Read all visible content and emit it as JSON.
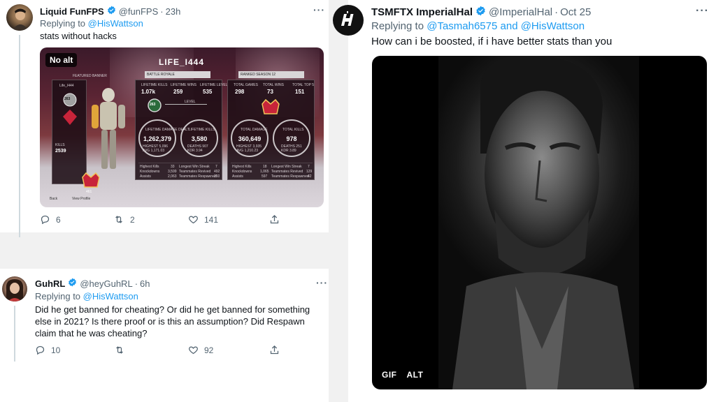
{
  "tweets": {
    "t1": {
      "name": "Liquid FunFPS",
      "handle": "@funFPS",
      "time": "23h",
      "reply_prefix": "Replying to",
      "reply_to": "@HisWattson",
      "text": "stats without hacks",
      "stats": {
        "replies": "6",
        "retweets": "2",
        "likes": "141"
      }
    },
    "t2": {
      "name": "GuhRL",
      "handle": "@heyGuhRL",
      "time": "6h",
      "reply_prefix": "Replying to",
      "reply_to": "@HisWattson",
      "text": "Did he get banned for cheating? Or did he get banned for something else in 2021? Is there proof or is this an assumption? Did Respawn claim that he was cheating?",
      "stats": {
        "replies": "10",
        "retweets": "",
        "likes": "92"
      }
    },
    "t3": {
      "name": "TSMFTX ImperialHal",
      "handle": "@ImperialHal",
      "time": "Oct 25",
      "reply_prefix": "Replying to",
      "reply_to": "@Tasmah6575 and @HisWattson",
      "text": "How can i be boosted, if i have better stats than you",
      "gif_label": "GIF",
      "alt_label": "ALT"
    }
  },
  "dot_separator": "·",
  "more_label": "···",
  "game": {
    "no_alt": "No alt",
    "player_title": "LIFE_I444",
    "featured_banner": "FEATURED BANNER",
    "banner_name": "Life_I444",
    "banner_rank": "263",
    "banner_stat_label": "KILLS",
    "banner_stat_value": "2539",
    "mode_dropdown": "BATTLE ROYALE",
    "ranked_dropdown": "RANKED SEASON 12",
    "left_tiles": [
      {
        "label": "LIFETIME KILLS",
        "value": "1.07k"
      },
      {
        "label": "LIFETIME WINS",
        "value": "259"
      },
      {
        "label": "LIFETIME LEVEL",
        "value": "535"
      }
    ],
    "level_label": "LEVEL",
    "level_value": "263",
    "lifetime_damage_label": "LIFETIME DAMAGE DEALT",
    "lifetime_damage": "1,262,379",
    "lifetime_damage_high": "HIGHEST 5,096",
    "lifetime_damage_avg": "AVG 1,171.03",
    "lifetime_kills_label": "LIFETIME KILLS",
    "lifetime_kills": "3,580",
    "lifetime_kills_high": "DEATHS 907",
    "lifetime_kills_kd": "KDR 3.94",
    "right_tiles": [
      {
        "label": "TOTAL GAMES",
        "value": "298"
      },
      {
        "label": "TOTAL WINS",
        "value": "73"
      },
      {
        "label": "TOTAL TOP 5",
        "value": "151"
      }
    ],
    "total_damage_label": "TOTAL DAMAGE",
    "total_damage": "360,649",
    "total_damage_high": "HIGHEST 3,935",
    "total_damage_avg": "AVG 1,210.23",
    "total_kills_label": "TOTAL KILLS",
    "total_kills": "978",
    "total_kills_deaths": "DEATHS 251",
    "total_kills_kd": "KDR 3.89",
    "left_rows": [
      {
        "a": "Highest Kills",
        "b": "33",
        "c": "Longest Win Streak",
        "d": "7"
      },
      {
        "a": "Knockdowns",
        "b": "3,599",
        "c": "Teammates Revived",
        "d": "492"
      },
      {
        "a": "Assists",
        "b": "2,063",
        "c": "Teammates Respawned",
        "d": "260"
      }
    ],
    "right_rows": [
      {
        "a": "Highest Kills",
        "b": "18",
        "c": "Longest Win Streak",
        "d": "7"
      },
      {
        "a": "Knockdowns",
        "b": "1,065",
        "c": "Teammates Revived",
        "d": "129"
      },
      {
        "a": "Assists",
        "b": "597",
        "c": "Teammates Respawned",
        "d": "42"
      }
    ],
    "bottom_label": "View Profile",
    "back_label": "Back",
    "level_badge": "461"
  }
}
